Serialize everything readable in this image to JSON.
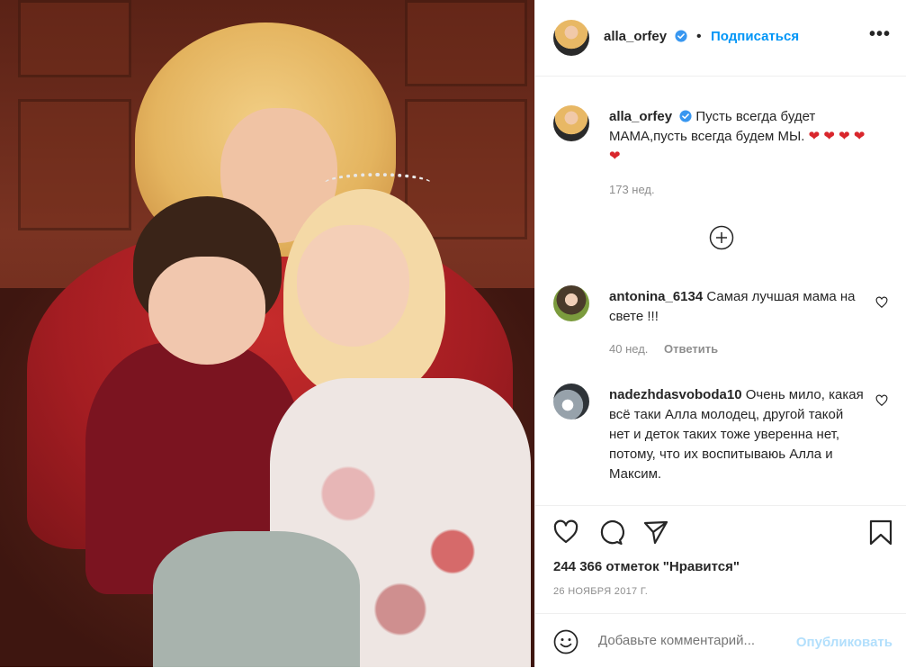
{
  "header": {
    "username": "alla_orfey",
    "separator": "•",
    "follow_label": "Подписаться",
    "more_label": "•••"
  },
  "caption": {
    "username": "alla_orfey",
    "text": "Пусть всегда будет МАМА,пусть всегда будем МЫ.",
    "emoji": "❤ ❤ ❤ ❤ ❤",
    "time": "173 нед."
  },
  "comments": [
    {
      "username": "antonina_6134",
      "text": "Самая лучшая мама на свете !!!",
      "time": "40 нед.",
      "reply_label": "Ответить"
    },
    {
      "username": "nadezhdasvoboda10",
      "text": "Очень мило, какая всё таки Алла молодец, другой такой нет и деток таких тоже уверенна нет, потому, что их воспитываюь Алла и Максим."
    }
  ],
  "stats": {
    "likes": "244 366 отметок \"Нравится\"",
    "date": "26 НОЯБРЯ 2017 Г."
  },
  "comment_box": {
    "placeholder": "Добавьте комментарий...",
    "publish_label": "Опубликовать"
  },
  "icons": {
    "verified": "verified-badge-icon",
    "like": "heart-icon",
    "comment": "comment-bubble-icon",
    "share": "paper-plane-icon",
    "save": "bookmark-icon",
    "emoji": "smiley-icon",
    "load_more": "plus-circle-icon"
  },
  "colors": {
    "link": "#0095f6",
    "verified": "#3897f0",
    "muted": "#8e8e8e",
    "heart_emoji": "#d9262c"
  }
}
